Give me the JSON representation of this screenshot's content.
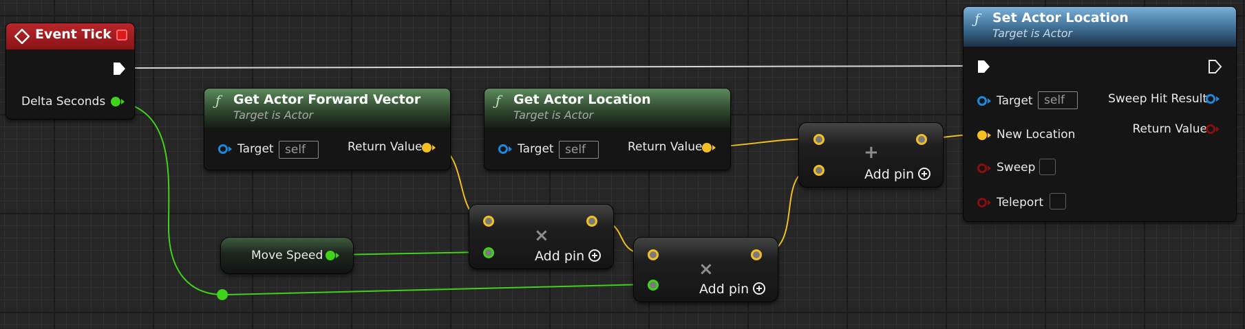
{
  "event_tick": {
    "title": "Event Tick",
    "delta_label": "Delta Seconds"
  },
  "forward_vector": {
    "title": "Get Actor Forward Vector",
    "subtitle": "Target is Actor",
    "target_label": "Target",
    "target_value": "self",
    "return_label": "Return Value"
  },
  "get_location": {
    "title": "Get Actor Location",
    "subtitle": "Target is Actor",
    "target_label": "Target",
    "target_value": "self",
    "return_label": "Return Value"
  },
  "set_location": {
    "title": "Set Actor Location",
    "subtitle": "Target is Actor",
    "target_label": "Target",
    "target_value": "self",
    "new_location_label": "New Location",
    "sweep_label": "Sweep",
    "teleport_label": "Teleport",
    "sweep_hit_label": "Sweep Hit Result",
    "return_label": "Return Value"
  },
  "move_speed": {
    "label": "Move Speed"
  },
  "multiply_1": {
    "symbol": "×",
    "add_pin_label": "Add pin"
  },
  "multiply_2": {
    "symbol": "×",
    "add_pin_label": "Add pin"
  },
  "add_node": {
    "symbol": "+",
    "add_pin_label": "Add pin"
  },
  "colors": {
    "vector_pin": "#f2c021",
    "float_pin": "#3fd31a",
    "object_pin": "#1a8ae0",
    "exec_wire": "#d8d8d8",
    "function_header": "#5c8a5c",
    "event_header": "#b8262a",
    "set_header": "#7ab0d8"
  },
  "icons": {
    "event": "event-diamond-icon",
    "function": "function-f-icon",
    "breakpoint": "stop-square-icon",
    "add_pin": "plus-circle-icon"
  }
}
